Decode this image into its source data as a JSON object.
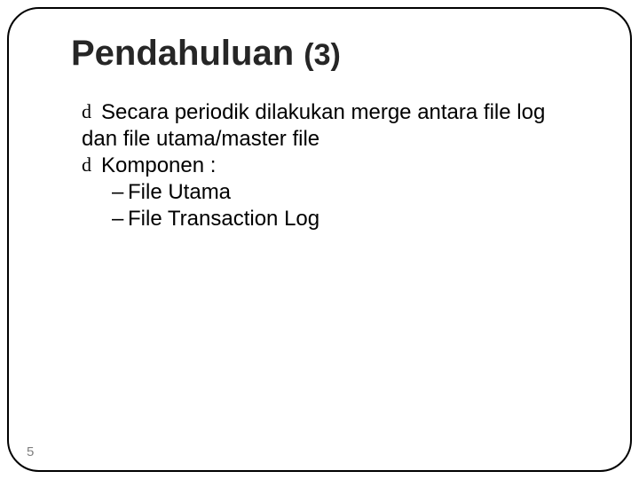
{
  "slide": {
    "title_main": "Pendahuluan ",
    "title_paren": "(3)",
    "bullets": [
      {
        "line1": "Secara periodik dilakukan merge antara file log",
        "line2": "dan file utama/master file"
      },
      {
        "line1": "Komponen :",
        "sub": [
          "File Utama",
          "File Transaction Log"
        ]
      }
    ],
    "page_number": "5",
    "glyphs": {
      "bullet": "d",
      "dash": "–"
    }
  }
}
